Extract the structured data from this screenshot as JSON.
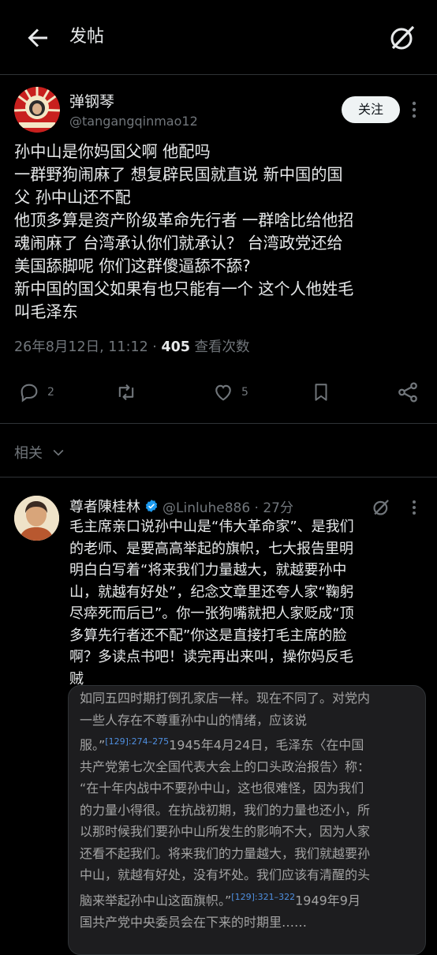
{
  "header": {
    "title": "发帖",
    "back_icon": "arrow-left-icon",
    "grok_icon": "grok-icon"
  },
  "post": {
    "author_name": "弹钢琴",
    "handle": "@tangangqinmao12",
    "follow_label": "关注",
    "lines": [
      "孙中山是你妈国父啊 他配吗",
      "一群野狗闹麻了 想复辟民国就直说 新中国的国",
      "父 孙中山还不配",
      "他顶多算是资产阶级革命先行者 一群啥比给他招",
      "魂闹麻了 台湾承认你们就承认？ 台湾政党还给",
      "美国舔脚呢 你们这群傻逼舔不舔?",
      "新中国的国父如果有也只能有一个 这个人他姓毛",
      "叫毛泽东"
    ],
    "date": "26年8月12日, 11:12",
    "separator": " · ",
    "views_count": "405",
    "views_label": " 查看次数",
    "reply_count": "2",
    "like_count": "5"
  },
  "related": {
    "label": "相关"
  },
  "reply": {
    "author_name": "尊者陳桂林",
    "handle_time": "@Linluhe886 · 27分",
    "lines": [
      "毛主席亲口说孙中山是“伟大革命家”、是我们",
      "的老师、是要高高举起的旗帜，七大报告里明",
      "明白白写着“将来我们力量越大，就越要孙中",
      "山，就越有好处”，纪念文章里还夸人家“鞠躬",
      "尽瘁死而后已”。你一张狗嘴就把人家贬成“顶",
      "多算先行者还不配”你这是直接打毛主席的脸",
      "啊？多读点书吧！读完再出来叫，操你妈反毛",
      "贼"
    ],
    "media": {
      "line0": "如同五四时期打倒孔家店一样。现在不同了。对党内",
      "line1": "一些人存在不尊重孙中山的情绪，应该说",
      "line2a": "服。”",
      "line2_ref": "[129]:274–275",
      "line2b": "1945年4月24日，毛泽东〈在中国",
      "line3": "共产党第七次全国代表大会上的口头政治报告〉称：",
      "line4": "“在十年内战中不要孙中山，这也很难怪，因为我们",
      "line5": "的力量小得很。在抗战初期，我们的力量也还小，所",
      "line6": "以那时候我们要孙中山所发生的影响不大，因为人家",
      "line7": "还看不起我们。将来我们的力量越大，我们就越要孙",
      "line8": "中山，就越有好处，没有坏处。我们应该有清醒的头",
      "line9a": "脑来举起孙中山这面旗帜。”",
      "line9_ref": "[129]:321–322",
      "line9b": "1949年9月",
      "line10": "国共产党中央委员会在下来的时期里……"
    }
  },
  "colors": {
    "background": "#000000",
    "text": "#e7e9ea",
    "muted": "#71767b",
    "verified": "#1d9bf0",
    "divider": "#2f3336"
  }
}
